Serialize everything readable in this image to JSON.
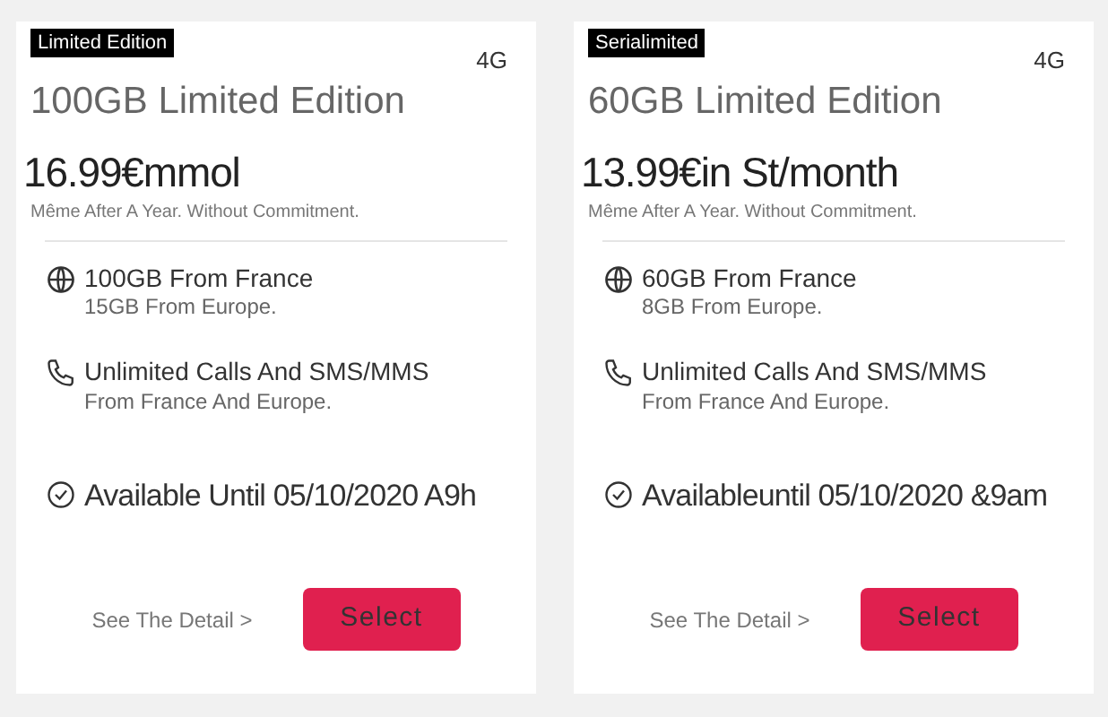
{
  "plans": [
    {
      "badge": "Limited Edition",
      "network": "4G",
      "title": "100GB Limited Edition",
      "price": "16.99€mmol",
      "price_note": "Même After A Year. Without Commitment.",
      "features": [
        {
          "kind": "data",
          "main": "100GB From France",
          "sub": "15GB From Europe."
        },
        {
          "kind": "calls",
          "main": "Unlimited Calls And SMS/MMS",
          "sub": "From France And Europe."
        },
        {
          "kind": "availability",
          "main": "Available Until 05/10/2020 A9h"
        }
      ],
      "detail_link": "See The Detail >",
      "select_button": "Select"
    },
    {
      "badge": "Serialimited",
      "network": "4G",
      "title": "60GB Limited Edition",
      "price": "13.99€in St/month",
      "price_note": "Même After A Year. Without Commitment.",
      "features": [
        {
          "kind": "data",
          "main": "60GB From France",
          "sub": "8GB From Europe."
        },
        {
          "kind": "calls",
          "main": "Unlimited Calls And SMS/MMS",
          "sub": "From France And Europe."
        },
        {
          "kind": "availability",
          "main": "Availableuntil 05/10/2020 &9am"
        }
      ],
      "detail_link": "See The Detail >",
      "select_button": "Select"
    }
  ]
}
